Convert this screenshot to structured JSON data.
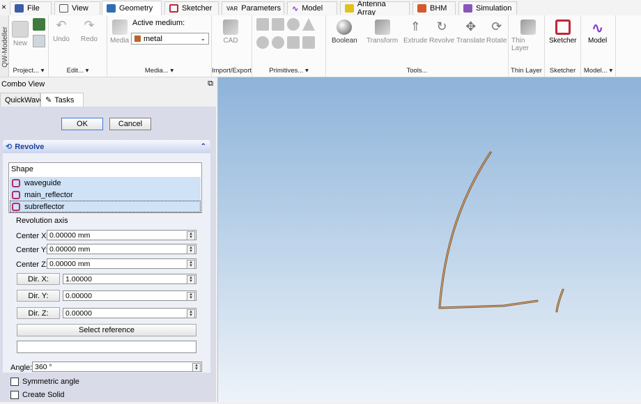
{
  "tabs": [
    {
      "label": "File",
      "icon": "file-icon",
      "color": "#3b5da8"
    },
    {
      "label": "View",
      "icon": "cube-outline-icon",
      "color": "#555555"
    },
    {
      "label": "Geometry",
      "icon": "geometry-cube-icon",
      "color": "#2f6db5"
    },
    {
      "label": "Sketcher",
      "icon": "sketcher-icon",
      "color": "#c0263a"
    },
    {
      "label": "Parameters",
      "icon": "var-icon",
      "color": "#444444"
    },
    {
      "label": "Model",
      "icon": "model-wave-icon",
      "color": "#8a3fc7"
    },
    {
      "label": "Antenna Array",
      "icon": "antenna-array-icon",
      "color": "#e0c21a"
    },
    {
      "label": "BHM",
      "icon": "bhm-icon",
      "color": "#d35a2a"
    },
    {
      "label": "Simulation",
      "icon": "simulation-icon",
      "color": "#8a56b8"
    }
  ],
  "vertical_label": "QW-Modeller",
  "ribbon": {
    "project": {
      "new": "New",
      "label": "Project..."
    },
    "edit": {
      "undo": "Undo",
      "redo": "Redo",
      "label": "Edit..."
    },
    "media": {
      "media": "Media",
      "active_medium_label": "Active medium:",
      "medium_value": "metal",
      "label": "Media..."
    },
    "import_export": {
      "cad": "CAD",
      "label": "Import/Export"
    },
    "primitives": {
      "label": "Primitives..."
    },
    "tools": {
      "boolean": "Boolean",
      "transform": "Transform",
      "extrude": "Extrude",
      "revolve": "Revolve",
      "translate": "Translate",
      "rotate": "Rotate",
      "label": "Tools..."
    },
    "thin_layer": {
      "btn": "Thin Layer",
      "label": "Thin Layer"
    },
    "sketcher": {
      "btn": "Sketcher",
      "label": "Sketcher"
    },
    "model": {
      "btn": "Model",
      "label": "Model..."
    }
  },
  "combo_view": {
    "title": "Combo View",
    "tabs": [
      {
        "label": "QuickWave"
      },
      {
        "label": "Tasks"
      }
    ]
  },
  "task": {
    "ok": "OK",
    "cancel": "Cancel",
    "panel_title": "Revolve",
    "shape_header": "Shape",
    "shapes": [
      "waveguide",
      "main_reflector",
      "subreflector"
    ],
    "axis_label": "Revolution axis",
    "center_x_label": "Center X:",
    "center_x": "0.00000 mm",
    "center_y_label": "Center Y:",
    "center_y": "0.00000 mm",
    "center_z_label": "Center Z:",
    "center_z": "0.00000 mm",
    "dir_x_label": "Dir. X:",
    "dir_x": "1.00000",
    "dir_y_label": "Dir. Y:",
    "dir_y": "0.00000",
    "dir_z_label": "Dir. Z:",
    "dir_z": "0.00000",
    "select_reference": "Select reference",
    "reference_value": "",
    "angle_label": "Angle:",
    "angle": "360 °",
    "symmetric": "Symmetric angle",
    "create_solid": "Create Solid"
  }
}
